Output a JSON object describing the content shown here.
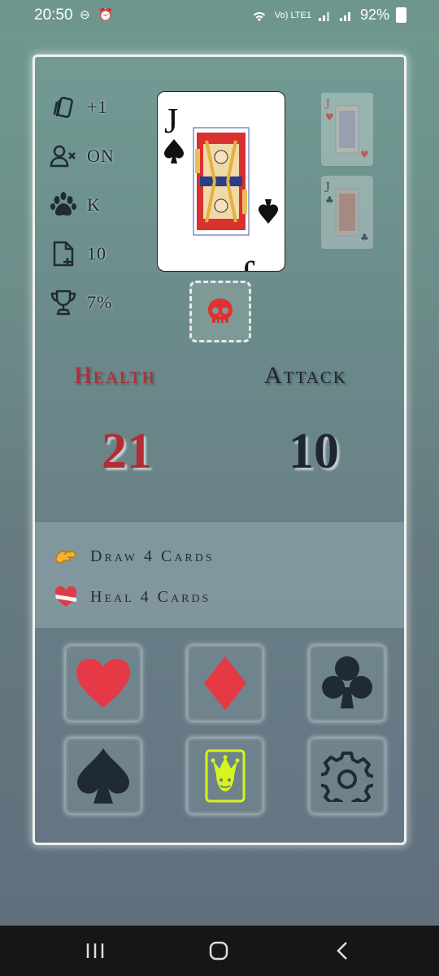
{
  "status_bar": {
    "time": "20:50",
    "left_icons": "⊖ ⏰",
    "network": "Vo) LTE1",
    "battery": "92%"
  },
  "stats": [
    {
      "icon": "cards-icon",
      "value": "+1"
    },
    {
      "icon": "user-x-icon",
      "value": "ON"
    },
    {
      "icon": "paw-icon",
      "value": "K"
    },
    {
      "icon": "file-plus-icon",
      "value": "10"
    },
    {
      "icon": "trophy-icon",
      "value": "7%"
    }
  ],
  "current_card": {
    "rank": "J",
    "suit": "spades"
  },
  "side_cards": [
    {
      "rank": "J",
      "suit": "hearts"
    },
    {
      "rank": "J",
      "suit": "clubs"
    }
  ],
  "slot": {
    "icon": "skull-icon",
    "color": "#e03131"
  },
  "health": {
    "label": "Health",
    "value": "21",
    "color": "#b12c34"
  },
  "attack": {
    "label": "Attack",
    "value": "10",
    "color": "#1d2632"
  },
  "actions": [
    {
      "icon": "pinch-hand-icon",
      "text": "Draw 4 Cards"
    },
    {
      "icon": "bandaged-heart-icon",
      "text": "Heal 4 Cards"
    }
  ],
  "buttons": [
    {
      "name": "hearts-button",
      "icon": "heart-suit-icon",
      "color": "#e63946"
    },
    {
      "name": "diamonds-button",
      "icon": "diamond-suit-icon",
      "color": "#e63946"
    },
    {
      "name": "clubs-button",
      "icon": "club-suit-icon",
      "color": "#1f2a36"
    },
    {
      "name": "spades-button",
      "icon": "spade-suit-icon",
      "color": "#1f2a36"
    },
    {
      "name": "joker-button",
      "icon": "joker-icon",
      "color": "#d4f51e"
    },
    {
      "name": "settings-button",
      "icon": "gear-icon",
      "color": "#1f2a36"
    }
  ]
}
